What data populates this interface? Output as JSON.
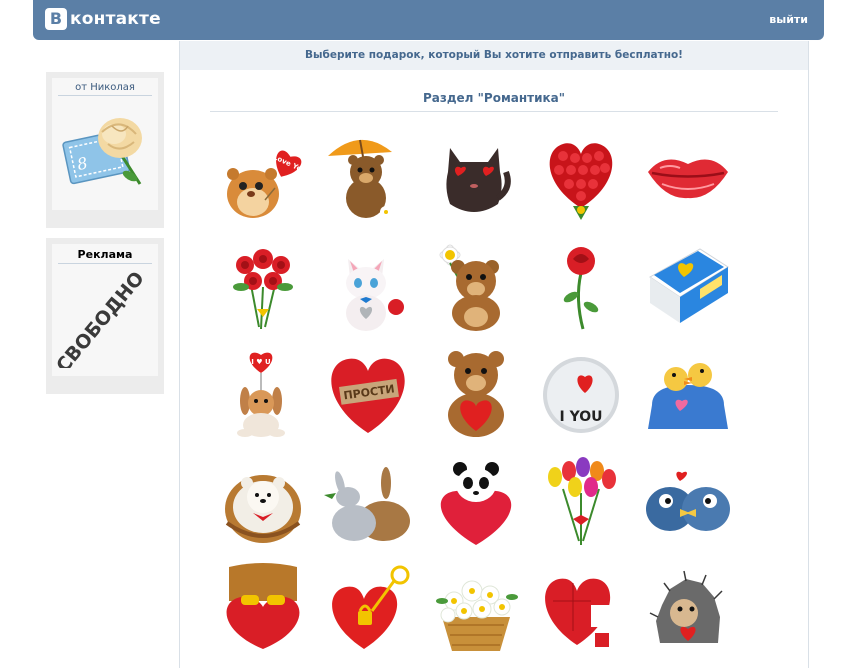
{
  "header": {
    "logo_letter": "B",
    "logo_text": "контакте",
    "logout": "выйти"
  },
  "sidebar": {
    "from_label": "от Николая",
    "ad_label": "Реклама",
    "ad_stamp": "СВОБОДНО"
  },
  "main": {
    "instruction": "Выберите подарок, который Вы хотите отправить бесплатно!",
    "section_title": "Раздел \"Романтика\""
  },
  "gifts": {
    "g3": {
      "text": "I Love You"
    },
    "g13": {
      "text": "ПРОСТИ"
    },
    "g15": {
      "text": "I YOU"
    }
  },
  "colors": {
    "header": "#5b7fa6",
    "link": "#45688e",
    "heart_red": "#e02020"
  }
}
